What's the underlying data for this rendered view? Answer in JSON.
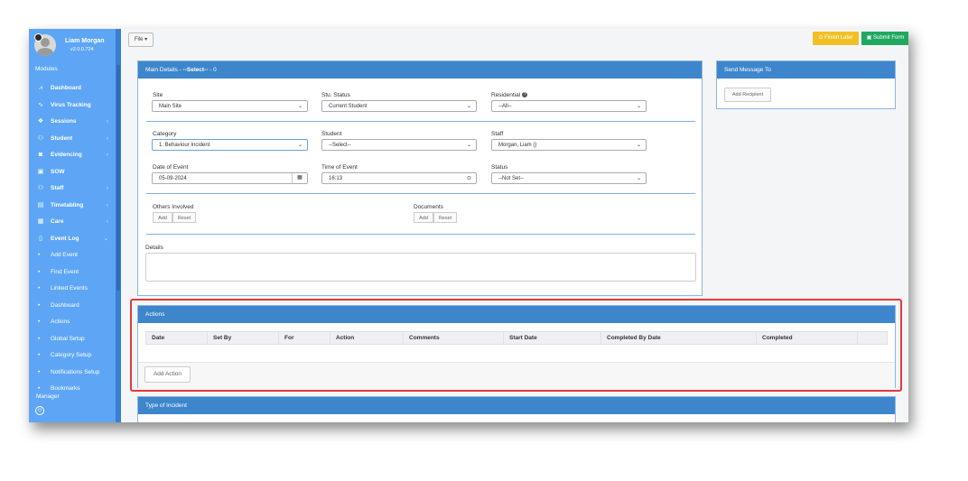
{
  "user": {
    "name": "Liam Morgan",
    "version": "v2.0.0.724"
  },
  "sidebar": {
    "modules_label": "Modules",
    "items": [
      {
        "label": "Dashboard",
        "icon": "chart-line-icon",
        "glyph": "⩘"
      },
      {
        "label": "Virus Tracking",
        "icon": "pulse-icon",
        "glyph": "∿"
      },
      {
        "label": "Sessions",
        "icon": "layers-icon",
        "glyph": "❖"
      },
      {
        "label": "Student",
        "icon": "users-icon",
        "glyph": "⚇"
      },
      {
        "label": "Evidencing",
        "icon": "camera-icon",
        "glyph": "◙"
      },
      {
        "label": "SOW",
        "icon": "book-icon",
        "glyph": "▣"
      },
      {
        "label": "Staff",
        "icon": "users-icon",
        "glyph": "⚇"
      },
      {
        "label": "Timetabling",
        "icon": "table-icon",
        "glyph": "▤"
      },
      {
        "label": "Care",
        "icon": "clipboard-icon",
        "glyph": "▦"
      },
      {
        "label": "Event Log",
        "icon": "file-icon",
        "glyph": "▯"
      }
    ],
    "sub_items": [
      {
        "label": "Add Event"
      },
      {
        "label": "Find Event"
      },
      {
        "label": "Linked Events"
      },
      {
        "label": "Dashboard"
      },
      {
        "label": "Actions"
      },
      {
        "label": "Global Setup"
      },
      {
        "label": "Category Setup"
      },
      {
        "label": "Notifications Setup"
      },
      {
        "label": "Bookmarks"
      }
    ],
    "bottom_label": "Manager",
    "power_glyph": "⏻"
  },
  "topbar": {
    "file_label": "File ▾",
    "finish_label": "⊙ Finish Later",
    "submit_label": "▣ Submit Form"
  },
  "main": {
    "title_prefix": "Main Details - ",
    "title_bold": "--Select--",
    "title_suffix": " - 0",
    "site": {
      "label": "Site",
      "value": "Main Site"
    },
    "stu_status": {
      "label": "Stu. Status",
      "value": "Current Student"
    },
    "residential": {
      "label": "Residential",
      "value": "--All--",
      "help": "?"
    },
    "category": {
      "label": "Category",
      "value": "1. Behaviour Incident"
    },
    "student": {
      "label": "Student",
      "value": "--Select--"
    },
    "staff": {
      "label": "Staff",
      "value": "Morgan, Liam ()"
    },
    "date_of_event": {
      "label": "Date of Event",
      "value": "05-09-2024",
      "icon_glyph": "▦"
    },
    "time_of_event": {
      "label": "Time of Event",
      "value": "16:13",
      "icon_glyph": "⊙"
    },
    "status": {
      "label": "Status",
      "value": "--Not Set--"
    },
    "others_involved": {
      "label": "Others Involved",
      "add": "Add",
      "reset": "Reset"
    },
    "documents": {
      "label": "Documents",
      "add": "Add",
      "reset": "Reset"
    },
    "details_label": "Details"
  },
  "message": {
    "title": "Send Message To",
    "add_recipient": "Add Recipient"
  },
  "actions": {
    "title": "Actions",
    "columns": [
      "Date",
      "Set By",
      "For",
      "Action",
      "Comments",
      "Start Date",
      "Completed By Date",
      "Completed"
    ],
    "add_label": "Add Action"
  },
  "incident": {
    "title": "Type of Incident"
  },
  "colors": {
    "sidebar": "#5ea6f5",
    "panel_header": "#3d86cc",
    "finish": "#f0c026",
    "submit": "#20a860",
    "highlight": "#e23a3a"
  }
}
